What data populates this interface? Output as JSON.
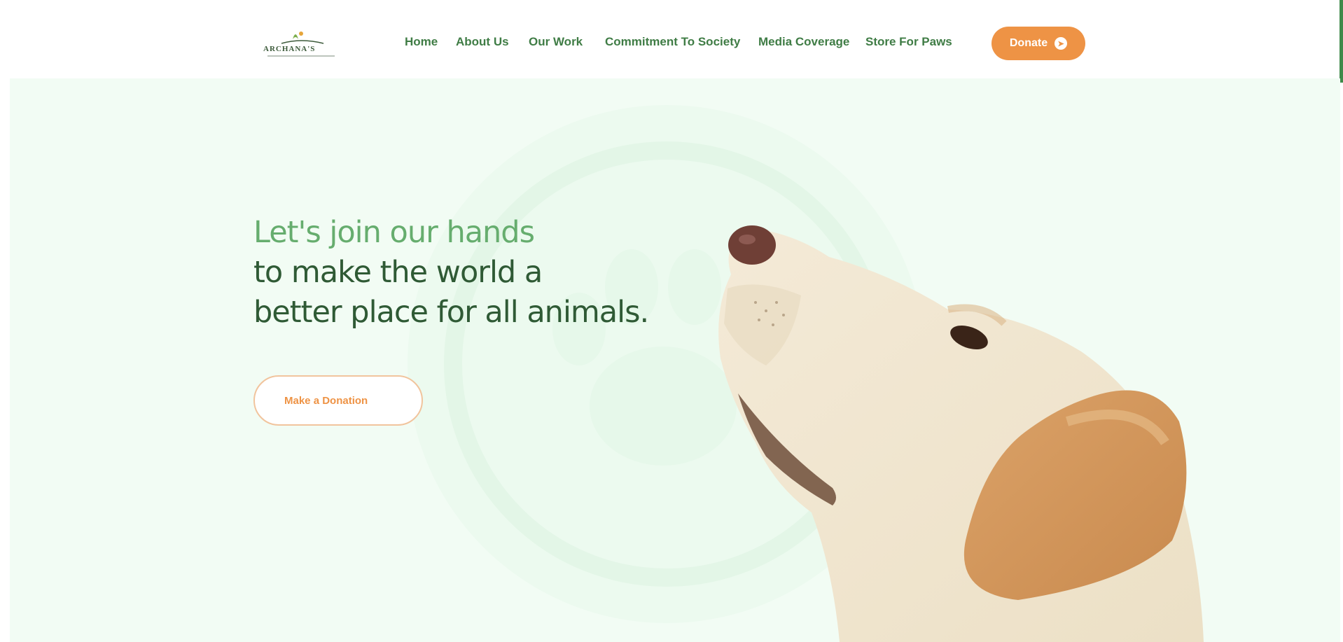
{
  "header": {
    "logo_text": "ARCHANA'S",
    "nav": [
      {
        "label": "Home"
      },
      {
        "label": "About Us"
      },
      {
        "label": "Our Work"
      },
      {
        "label": "Commitment To Society"
      },
      {
        "label": "Media Coverage"
      },
      {
        "label": "Store For Paws"
      }
    ],
    "donate_label": "Donate"
  },
  "hero": {
    "heading_line1": "Let's join our hands",
    "heading_line2": "to make the world a",
    "heading_line3": "better place for all animals.",
    "cta_label": "Make a Donation"
  },
  "colors": {
    "primary_green": "#3f7c45",
    "light_green": "#66ad6e",
    "dark_green": "#2f5a35",
    "accent_orange": "#ee9345",
    "hero_background": "#f2fcf4"
  }
}
